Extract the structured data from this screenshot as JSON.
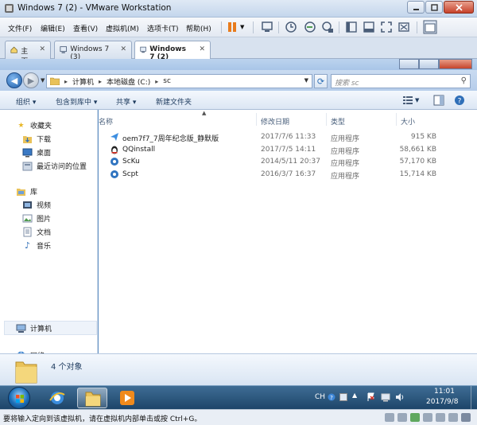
{
  "vmware": {
    "title": "Windows 7 (2) - VMware Workstation",
    "menu": [
      "文件(F)",
      "编辑(E)",
      "查看(V)",
      "虚拟机(M)",
      "选项卡(T)",
      "帮助(H)"
    ],
    "tabs": [
      {
        "label": "主页",
        "icon": "home-icon"
      },
      {
        "label": "Windows 7 (3)",
        "icon": "vm-icon"
      },
      {
        "label": "Windows 7 (2)",
        "icon": "vm-icon"
      }
    ],
    "status_message": "要将输入定向到该虚拟机，请在虚拟机内部单击或按 Ctrl+G。"
  },
  "explorer": {
    "breadcrumb": [
      "计算机",
      "本地磁盘 (C:)",
      "sc"
    ],
    "search_placeholder": "搜索 sc",
    "commands": [
      "组织 ▾",
      "包含到库中 ▾",
      "共享 ▾",
      "新建文件夹"
    ],
    "nav": {
      "favorites": "收藏夹",
      "downloads": "下载",
      "desktop": "桌面",
      "recent": "最近访问的位置",
      "libraries": "库",
      "videos": "视频",
      "pictures": "图片",
      "documents": "文档",
      "music": "音乐",
      "computer": "计算机",
      "network": "网络"
    },
    "columns": {
      "name": "名称",
      "date": "修改日期",
      "type": "类型",
      "size": "大小"
    },
    "files": [
      {
        "name": "oem7f7_7周年纪念版_静默版",
        "date": "2017/7/6 11:33",
        "type": "应用程序",
        "size": "915 KB",
        "icon": "paper-plane-icon"
      },
      {
        "name": "QQinstall",
        "date": "2017/7/5 14:11",
        "type": "应用程序",
        "size": "58,661 KB",
        "icon": "penguin-icon"
      },
      {
        "name": "ScKu",
        "date": "2014/5/11 20:37",
        "type": "应用程序",
        "size": "57,170 KB",
        "icon": "app-gear-icon"
      },
      {
        "name": "Scpt",
        "date": "2016/3/7 16:37",
        "type": "应用程序",
        "size": "15,714 KB",
        "icon": "app-gear-icon"
      }
    ],
    "item_count": "4 个对象"
  },
  "taskbar": {
    "lang": "CH",
    "time": "11:01",
    "date": "2017/9/8"
  },
  "colors": {
    "accent": "#1c6fb8",
    "folder": "#f0c75e"
  }
}
